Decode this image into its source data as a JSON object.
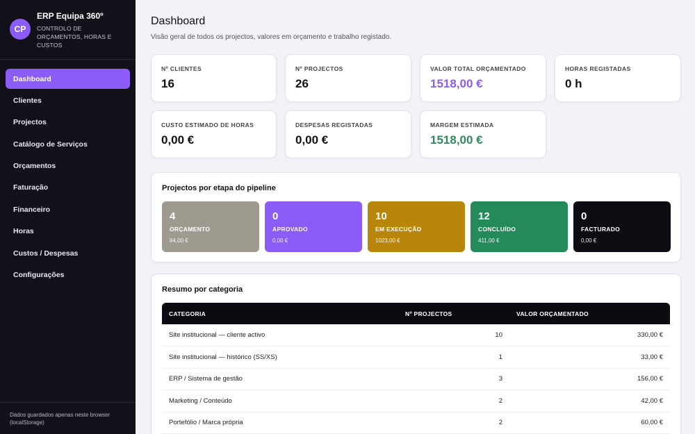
{
  "sidebar": {
    "avatar": "CP",
    "title": "ERP Equipa 360º",
    "subtitle": "Controlo de orçamentos, horas e custos",
    "items": [
      {
        "label": "Dashboard",
        "active": true
      },
      {
        "label": "Clientes"
      },
      {
        "label": "Projectos"
      },
      {
        "label": "Catálogo de Serviços"
      },
      {
        "label": "Orçamentos"
      },
      {
        "label": "Faturação"
      },
      {
        "label": "Financeiro"
      },
      {
        "label": "Horas"
      },
      {
        "label": "Custos / Despesas"
      },
      {
        "label": "Configurações"
      }
    ],
    "footer": "Dados guardados apenas neste browser (localStorage)"
  },
  "header": {
    "title": "Dashboard",
    "subtitle": "Visão geral de todos os projectos, valores em orçamento e trabalho registado."
  },
  "kpis": [
    {
      "label": "Nº Clientes",
      "value": "16"
    },
    {
      "label": "Nº Projectos",
      "value": "26"
    },
    {
      "label": "Valor total orçamentado",
      "value": "1518,00 €"
    },
    {
      "label": "Horas registadas",
      "value": "0 h"
    },
    {
      "label": "Custo estimado de horas",
      "value": "0,00 €"
    },
    {
      "label": "Despesas registadas",
      "value": "0,00 €"
    },
    {
      "label": "Margem estimada",
      "value": "1518,00 €"
    }
  ],
  "pipeline": {
    "title": "Projectos por etapa do pipeline",
    "stages": [
      {
        "count": "4",
        "name": "Orçamento",
        "value": "84,00 €",
        "color": "#9e9a90"
      },
      {
        "count": "0",
        "name": "Aprovado",
        "value": "0,00 €",
        "color": "#8b5cf6"
      },
      {
        "count": "10",
        "name": "Em execução",
        "value": "1023,00 €",
        "color": "#b8860b"
      },
      {
        "count": "12",
        "name": "Concluído",
        "value": "411,00 €",
        "color": "#248a5a"
      },
      {
        "count": "0",
        "name": "Facturado",
        "value": "0,00 €",
        "color": "#0d0c12"
      }
    ]
  },
  "summary": {
    "title": "Resumo por categoria",
    "columns": [
      "Categoria",
      "Nº Projectos",
      "Valor orçamentado"
    ],
    "rows": [
      {
        "category": "Site institucional — cliente activo",
        "projects": "10",
        "value": "330,00 €"
      },
      {
        "category": "Site institucional — histórico (SS/XS)",
        "projects": "1",
        "value": "33,00 €"
      },
      {
        "category": "ERP / Sistema de gestão",
        "projects": "3",
        "value": "156,00 €"
      },
      {
        "category": "Marketing / Conteúdo",
        "projects": "2",
        "value": "42,00 €"
      },
      {
        "category": "Portefólio / Marca própria",
        "projects": "2",
        "value": "60,00 €"
      }
    ]
  },
  "colors": {
    "accent": "#8b5cf6",
    "sidebar_bg": "#12111a",
    "positive": "#2f8a5b"
  }
}
